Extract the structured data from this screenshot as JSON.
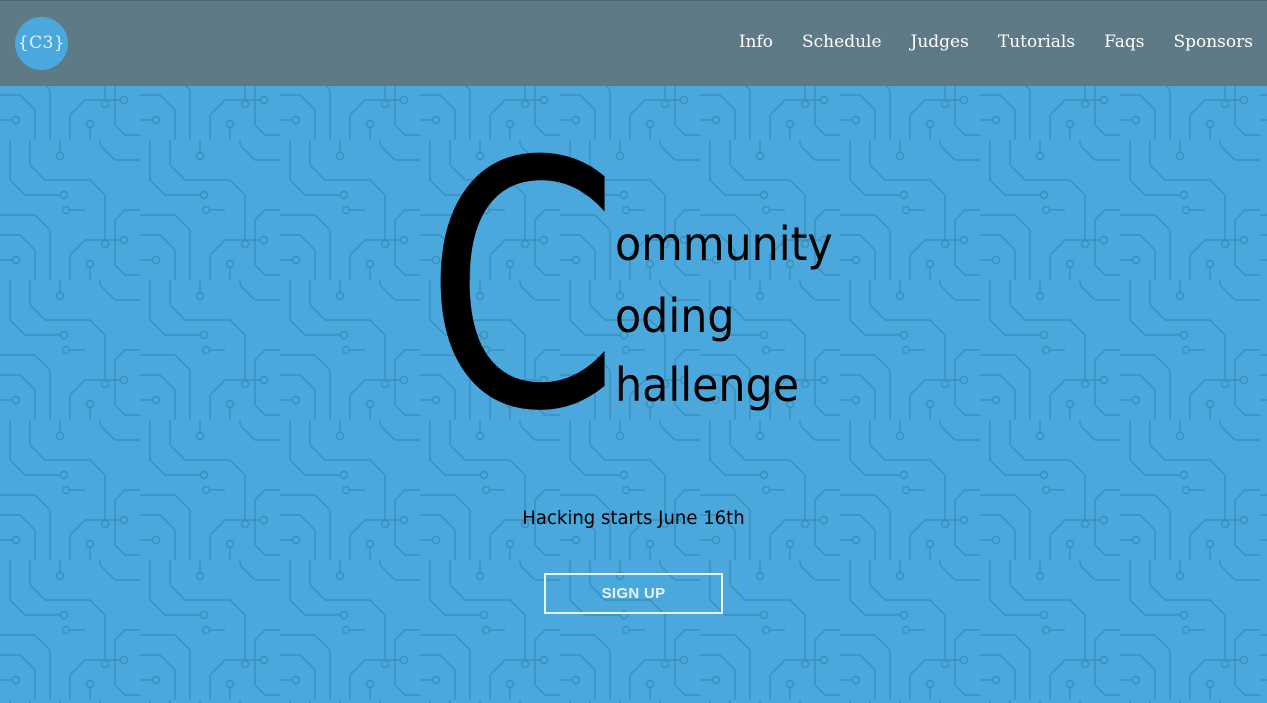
{
  "header": {
    "logo_text": "{C3}",
    "nav": [
      "Info",
      "Schedule",
      "Judges",
      "Tutorials",
      "Faqs",
      "Sponsors"
    ]
  },
  "hero": {
    "big_letter": "C",
    "lines": [
      "ommunity",
      "oding",
      "hallenge"
    ],
    "subtitle": "Hacking starts June 16th",
    "cta_label": "SIGN UP"
  },
  "colors": {
    "header_bg": "#5e7a86",
    "hero_bg": "#4aa8dc",
    "circuit_lines": "#3a8fbf"
  },
  "background_pattern": "circuit-board"
}
